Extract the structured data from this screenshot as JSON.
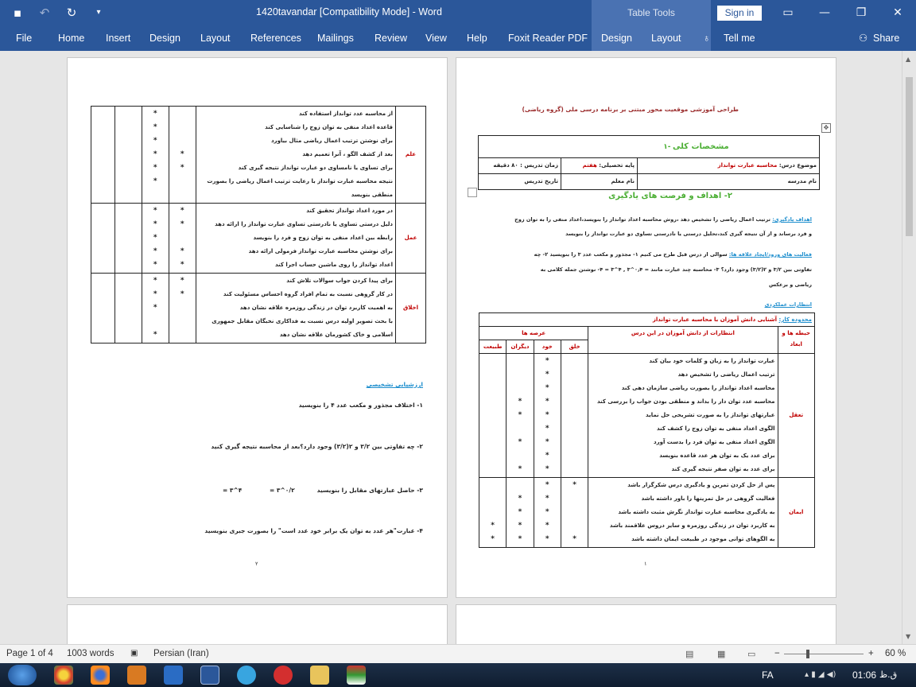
{
  "window": {
    "title": "1420tavandar [Compatibility Mode]  -  Word",
    "table_tools": "Table Tools",
    "sign_in": "Sign in"
  },
  "ribbon": {
    "tabs": [
      "File",
      "Home",
      "Insert",
      "Design",
      "Layout",
      "References",
      "Mailings",
      "Review",
      "View",
      "Help",
      "Foxit Reader PDF",
      "Design",
      "Layout"
    ],
    "tell_me": "Tell me",
    "share": "Share"
  },
  "page_right": {
    "heading": "طراحی آموزشی موقعیت محور مبتنی بر برنامه درسی ملی (گروه ریاضی)",
    "sec1_num": "-۱",
    "sec1_title": "مشخصات کلی",
    "topic_label": "موضوع درس:",
    "topic_value": "محاسبه عبارت توانداز",
    "grade_label": "پایه تحصیلی:",
    "grade_value": "هفتم",
    "time_label": "زمان تدریس : ۸۰ دقیقه",
    "school_label": "نام مدرسه",
    "teacher_label": "نام معلم",
    "date_label": "تاریخ تدریس",
    "sec2_title": "۲- اهداف و فرصت های یادگیری",
    "goals_label": "اهداف یادگیری:",
    "goals_text_1": "ترتیب اعمال ریاضی را تشخیص دهد ،روش محاسبه اعداد توانداز را بنویسد،اعداد منفی را به توان زوج",
    "goals_text_2": "و فرد برساند و از آن نتیجه گیری کند،تحلیل درستی یا نادرستی تساوی دو عبارت توانداز را بنویسد",
    "act_label": "فعالیت های ورود/ایجاد علاقه ها:",
    "act_text_1": "سوالی از درس قبل طرح می کنیم ۱- مجذور و مکعب عدد ۳ را بنویسید ۲- چه",
    "act_text_2": "تفاوتی بین  ۳/۲  و  ۲(۳/۲)  وجود دارد؟ ۳- محاسبه چند عبارت مانند  = ۰٫۴^۳ , ۴^۳ = ۴- نوشتن جمله کلامی به",
    "act_text_3": "ریاضی و برعکس",
    "expect_label": "انتظارات عملکردی",
    "topic_sub_label": "محدوده کار:",
    "topic_sub_value": "آشنایی دانش آموزان با محاسبه عبارت توانداز",
    "table_header_domain": "حیطه ها و ابعاد",
    "table_header_expect": "انتظارات از دانش آموزان در این درس",
    "table_header_areas": "عرصه ها",
    "table_areas": [
      "خلق",
      "خود",
      "دیگران",
      "طبیعت"
    ],
    "rows_1_domain": "تعقل",
    "rows_1": [
      "عبارت توانداز را به زبان و کلمات خود بیان کند",
      "ترتیب اعمال ریاضی را تشخیص دهد",
      "محاسبه اعداد توانداز را بصورت ریاضی سازمان دهی کند",
      "محاسبه عدد توان دار را بداند و منطقی بودن جواب را بررسی کند",
      "عبارتهای توانداز را به صورت تشریحی حل نماید",
      "الگوی اعداد منفی به توان زوج را کشف کند",
      "الگوی اعداد منفی به توان فرد را بدست آورد",
      "برای عدد یک به توان هر عدد قاعده بنویسد",
      "برای عدد به توان صفر نتیجه گیری کند"
    ],
    "rows_2_domain": "ایمان",
    "rows_2": [
      "پس از حل کردن تمرین و یادگیری درس شکرگزار باشد",
      "فعالیت گروهی در حل تمرینها را باور داشته باشد",
      "به یادگیری محاسبه عبارت توانداز نگرش مثبت داشته باشد",
      "به کاربرد توان در زندگی روزمره و سایر دروس علاقمند باشد",
      "به الگوهای توانی موجود در طبیعت ایمان داشته باشد"
    ],
    "page_num": "۱"
  },
  "page_left": {
    "rows_1_domain": "علم",
    "rows_1": [
      "از محاسبه عدد توانداز استفاده کند",
      "قاعده اعداد منفی به توان زوج را شناسایی کند",
      "برای نوشتن ترتیب اعمال ریاضی مثال بیاورد",
      "بعد از کشف الگو ، آنرا تعمیم دهد",
      "برای تساوی یا نامساوی دو عبارت توانداز نتیجه گیری کند",
      "نتیجه محاسبه عبارت توانداز با رعایت ترتیب اعمال ریاضی را بصورت منطقی بنویسد"
    ],
    "rows_2_domain": "عمل",
    "rows_2": [
      "در مورد اعداد توانداز تحقیق کند",
      "دلیل درستی تساوی یا نادرستی تساوی عبارت توانداز را ارائه دهد",
      "رابطه بین اعداد منفی به توان زوج و فرد را بنویسد",
      "برای نوشتن محاسبه عبارت توانداز فرمولی ارائه دهد",
      "اعداد توانداز را روی ماشین حساب اجرا کند"
    ],
    "rows_3_domain": "اخلاق",
    "rows_3": [
      "برای پیدا کردن جواب سوالات تلاش کند",
      "در کار گروهی نسبت به تمام افراد گروه احساس مسئولیت کند",
      "به اهمیت کاربرد توان در زندگی روزمره علاقه نشان دهد",
      "با بحث تصویر اولیه درس نسبت به فداکاری نخبگان مقابل جمهوری اسلامی و خاک کشورمان علاقه نشان دهد"
    ],
    "assess_title": "ارزشیابی تشخیصی",
    "q1": "۱- اختلاف مجذور و مکعب عدد ۴ را بنویسید",
    "q2": "۲- چه تفاوتی بین  ۳/۲  و  ۲(۳/۲)  وجود دارد؟بعد از محاسبه نتیجه گیری کنید",
    "q3": "۳- حاصل عبارتهای مقابل را بنویسید",
    "q3_a": "۴^۳ =",
    "q3_b": "۰/۲^۳ =",
    "q4": "۴- عبارت\"هر عدد به توان یک برابر خود عدد است\" را بصورت جبری بنویسید",
    "page_num": "۲"
  },
  "status": {
    "page": "Page 1 of 4",
    "words": "1003 words",
    "language": "Persian (Iran)",
    "zoom": "60 %"
  },
  "taskbar": {
    "lang": "FA",
    "time": "01:06",
    "ampm": "ق.ظ"
  }
}
